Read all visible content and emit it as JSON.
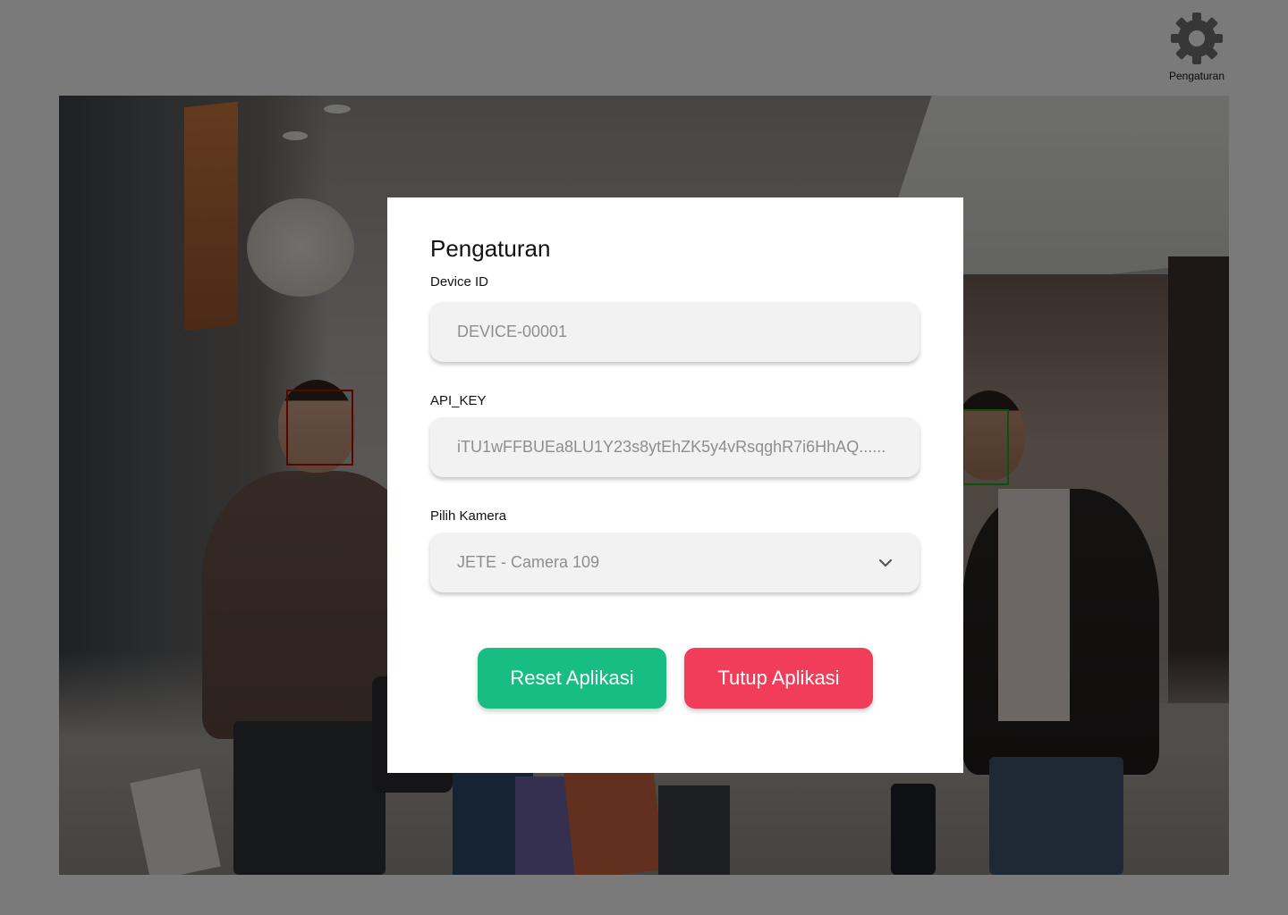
{
  "settings": {
    "label": "Pengaturan",
    "icon": "gear-icon",
    "icon_color": "#6e6e6e"
  },
  "camera_feed": {
    "face_detections": [
      {
        "status": "unrecognized",
        "color": "#b20a0a"
      },
      {
        "status": "recognized",
        "color": "#1ca11c"
      }
    ]
  },
  "modal": {
    "title": "Pengaturan",
    "device_id": {
      "label": "Device ID",
      "value": "DEVICE-00001"
    },
    "api_key": {
      "label": "API_KEY",
      "value": "iTU1wFFBUEa8LU1Y23s8ytEhZK5y4vRsqghR7i6HhAQ......"
    },
    "camera": {
      "label": "Pilih Kamera",
      "selected": "JETE - Camera 109",
      "icon": "chevron-down-icon"
    },
    "reset_button": {
      "label": "Reset Aplikasi",
      "color": "#17bd82"
    },
    "close_button": {
      "label": "Tutup Aplikasi",
      "color": "#f23d5a"
    }
  }
}
